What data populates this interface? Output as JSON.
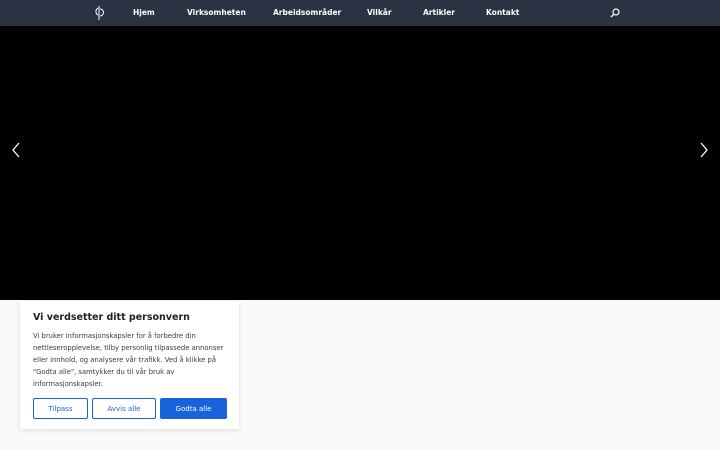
{
  "nav": {
    "items": [
      {
        "label": "Hjem"
      },
      {
        "label": "Virksomheten"
      },
      {
        "label": "Arbeidsområder"
      },
      {
        "label": "Vilkår"
      },
      {
        "label": "Artikler"
      },
      {
        "label": "Kontakt"
      }
    ]
  },
  "cookie": {
    "title": "Vi verdsetter ditt personvern",
    "body": "Vi bruker informasjonskapsler for å forbedre din nettleseropplevelse, tilby personlig tilpassede annonser eller innhold, og analysere vår trafikk. Ved å klikke på \"Godta alle\", samtykker du til vår bruk av informasjonskapsler.",
    "customize_label": "Tilpass",
    "reject_label": "Avvis alle",
    "accept_label": "Godta alle"
  },
  "colors": {
    "navbar": "#2b3244",
    "hero": "#000000",
    "accent": "#1863dc"
  },
  "icons": {
    "logo": "logo-icon",
    "search": "search-icon",
    "prev": "chevron-left-icon",
    "next": "chevron-right-icon"
  }
}
